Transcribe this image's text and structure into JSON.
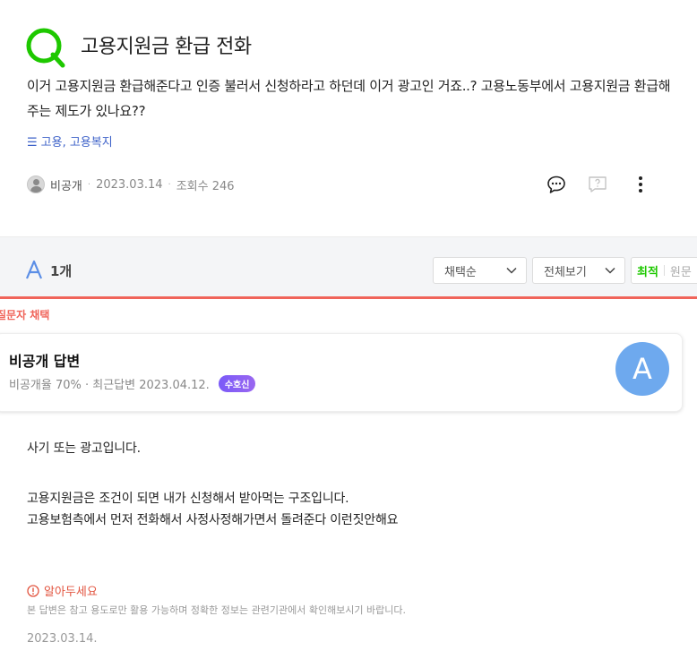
{
  "question": {
    "title": "고용지원금 환급 전화",
    "body": "이거 고용지원금 환급해준다고 인증 불러서 신청하라고 하던데 이거 광고인 거죠..? 고용노동부에서 고용지원금 환급해주는 제도가 있나요??",
    "tags_menu_glyph": "☰",
    "tags": "고용, 고용복지",
    "author": "비공개",
    "date": "2023.03.14",
    "views": "조회수 246"
  },
  "answers_header": {
    "count": "1개",
    "sort_select": "채택순",
    "filter_select": "전체보기",
    "sort_latest": "최적",
    "sort_original": "원문"
  },
  "chosen_label": "질문자 채택",
  "answer": {
    "name": "비공개 답변",
    "stats": "비공개율 70% · 최근답변 2023.04.12.",
    "badge": "수호신",
    "avatar_letter": "A",
    "lines": [
      "사기 또는 광고입니다.",
      "고용지원금은 조건이 되면 내가 신청해서 받아먹는 구조입니다.",
      "고용보험측에서 먼저 전화해서 사정사정해가면서 돌려준다 이런짓안해요"
    ],
    "notice_title": "알아두세요",
    "notice_text": "본 답변은 참고 용도로만 활용 가능하며 정확한 정보는 관련기관에서 확인해보시기 바랍니다.",
    "date": "2023.03.14."
  },
  "colors": {
    "q_logo": "#1ec800",
    "accent_blue": "#3f63c9",
    "chosen_red": "#f0645a",
    "avatar_blue": "#6ea9ee"
  }
}
